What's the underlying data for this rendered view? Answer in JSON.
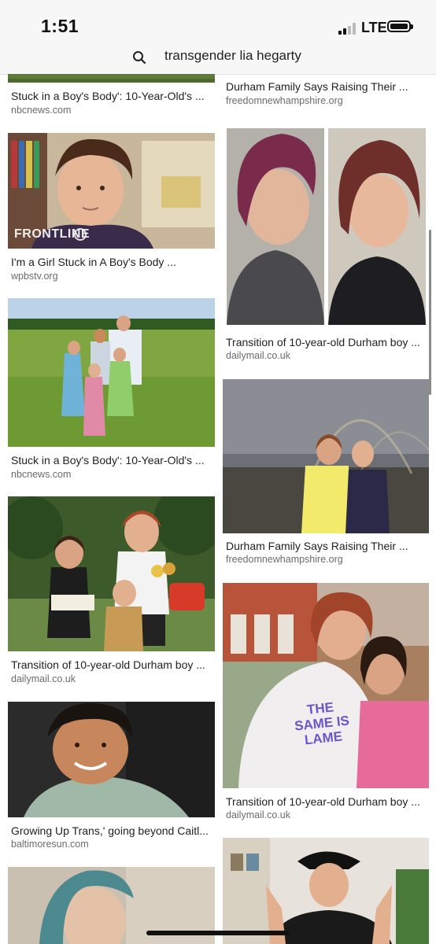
{
  "status_bar": {
    "time": "1:51",
    "network": "LTE"
  },
  "search": {
    "query": "transgender lia hegarty",
    "icon": "magnifier-icon"
  },
  "left_column": [
    {
      "caption": "Stuck in a Boy's Body': 10-Year-Old's ...",
      "source": "nbcnews.com"
    },
    {
      "caption": "I'm a Girl Stuck in A Boy's Body ...",
      "source": "wpbstv.org",
      "watermark": "FRONTLINE"
    },
    {
      "caption": "Stuck in a Boy's Body': 10-Year-Old's ...",
      "source": "nbcnews.com"
    },
    {
      "caption": "Transition of 10-year-old Durham boy ...",
      "source": "dailymail.co.uk"
    },
    {
      "caption": "Growing Up Trans,' going beyond Caitl...",
      "source": "baltimoresun.com"
    }
  ],
  "right_column": [
    {
      "caption": "Durham Family Says Raising Their ...",
      "source": "freedomnewhampshire.org"
    },
    {
      "caption": "Transition of 10-year-old Durham boy ...",
      "source": "dailymail.co.uk"
    },
    {
      "caption": "Durham Family Says Raising Their ...",
      "source": "freedomnewhampshire.org"
    },
    {
      "caption": "Transition of 10-year-old Durham boy ...",
      "source": "dailymail.co.uk",
      "shirt_text": "THE SAME IS LAME"
    }
  ]
}
